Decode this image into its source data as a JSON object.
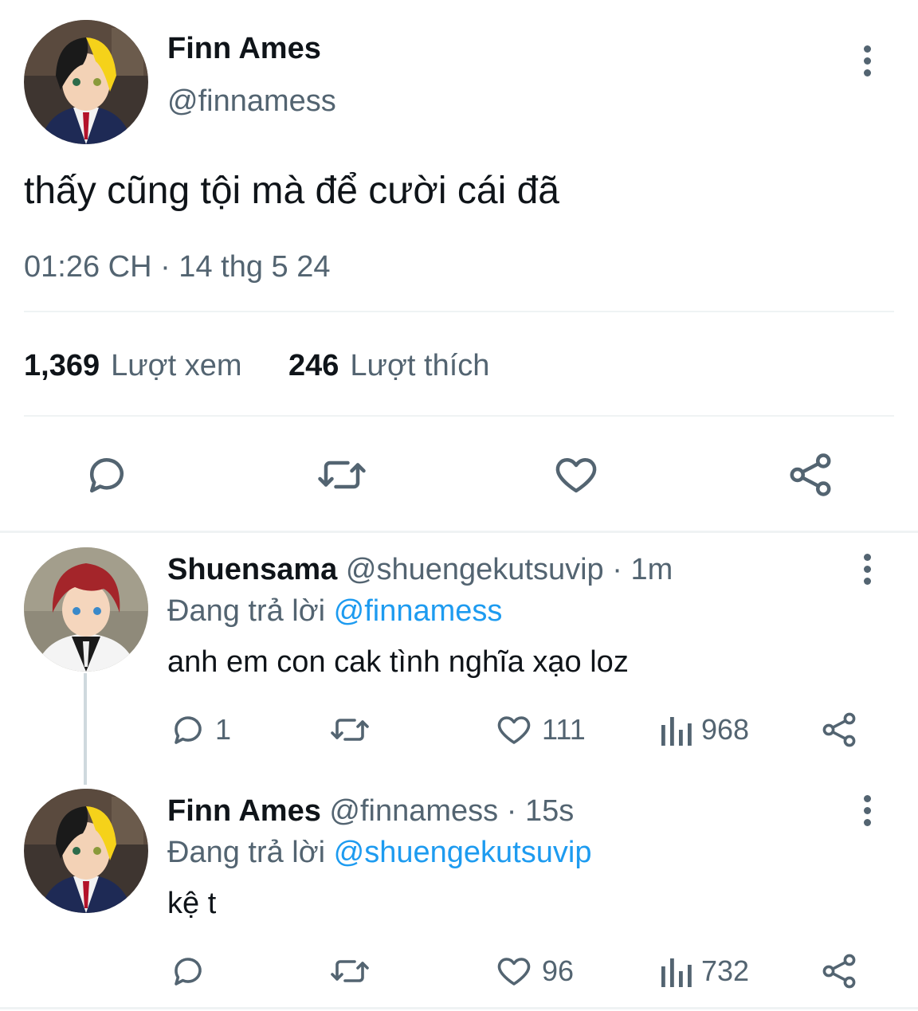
{
  "main_tweet": {
    "author_name": "Finn Ames",
    "handle": "@finnamess",
    "text": "thấy cũng tội mà để cười cái đã",
    "timestamp": "01:26 CH · 14 thg 5 24",
    "views_count": "1,369",
    "views_label": "Lượt xem",
    "likes_count": "246",
    "likes_label": "Lượt thích",
    "avatar_icon": "anime-avatar-black-yellow-hair"
  },
  "replies": [
    {
      "author_name": "Shuensama",
      "handle": "@shuengekutsuvip",
      "time": "1m",
      "replying_label": "Đang trả lời",
      "replying_to": "@finnamess",
      "text": "anh em con cak tình nghĩa xạo loz",
      "reply_count": "1",
      "retweet_count": "",
      "like_count": "111",
      "views_count": "968",
      "avatar_icon": "anime-avatar-red-hair"
    },
    {
      "author_name": "Finn Ames",
      "handle": "@finnamess",
      "time": "15s",
      "replying_label": "Đang trả lời",
      "replying_to": "@shuengekutsuvip",
      "text": "kệ t",
      "reply_count": "",
      "retweet_count": "",
      "like_count": "96",
      "views_count": "732",
      "avatar_icon": "anime-avatar-black-yellow-hair"
    }
  ],
  "separator": "·",
  "colors": {
    "text": "#0f1419",
    "muted": "#536471",
    "link": "#1d9bf0",
    "divider": "#eff3f4"
  }
}
